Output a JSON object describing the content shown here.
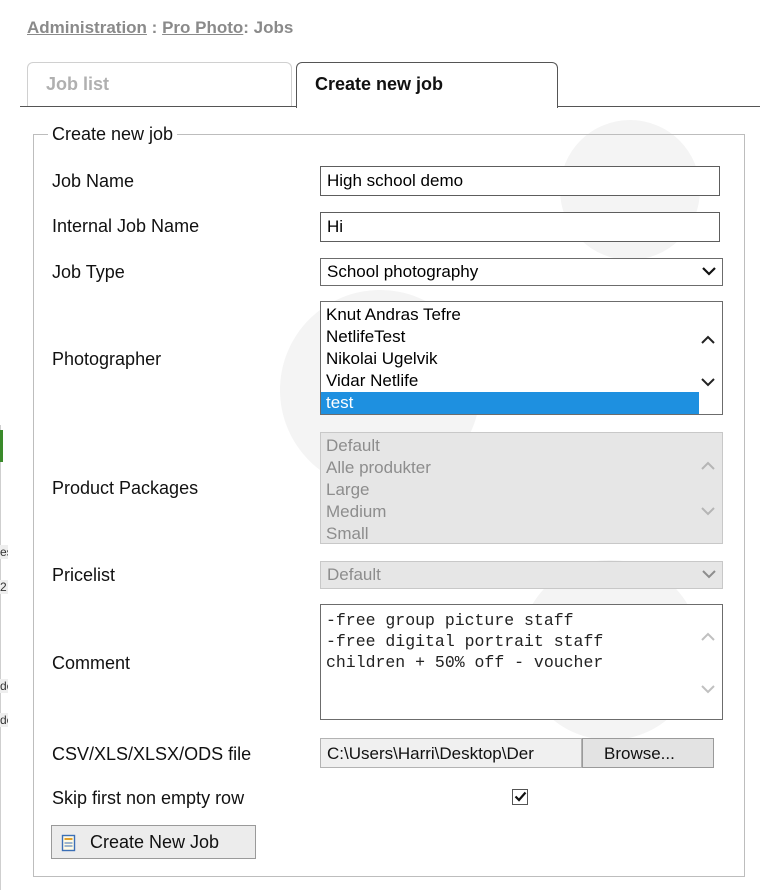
{
  "breadcrumb": {
    "link1": "Administration",
    "sep1": " : ",
    "link2": "Pro Photo",
    "tail": ": Jobs"
  },
  "tabs": {
    "job_list": "Job list",
    "create_new_job": "Create new job"
  },
  "form": {
    "legend": "Create new job",
    "job_name": {
      "label": "Job Name",
      "value": "High school demo"
    },
    "internal_job_name": {
      "label": "Internal Job Name",
      "value": "Hi"
    },
    "job_type": {
      "label": "Job Type",
      "selected": "School photography"
    },
    "photographer": {
      "label": "Photographer",
      "options": [
        "Knut Andras Tefre",
        "NetlifeTest",
        "Nikolai Ugelvik",
        "Vidar Netlife",
        "test"
      ],
      "selected_index": 4
    },
    "product_packages": {
      "label": "Product Packages",
      "options": [
        "Default",
        "Alle produkter",
        "Large",
        "Medium",
        "Small"
      ]
    },
    "pricelist": {
      "label": "Pricelist",
      "selected": "Default"
    },
    "comment": {
      "label": "Comment",
      "lines": [
        "-free group picture staff",
        "-free digital portrait staff",
        "children + 50% off - voucher"
      ]
    },
    "file": {
      "label": "CSV/XLS/XLSX/ODS file",
      "path": "C:\\Users\\Harri\\Desktop\\Der",
      "browse": "Browse..."
    },
    "skip_first_row": {
      "label": "Skip first non empty row",
      "checked": true
    },
    "submit": "Create New Job"
  },
  "background_fragments": {
    "frag1": "es",
    "frag2": "2",
    "frag3": "de",
    "frag4": "de"
  },
  "colors": {
    "selection": "#1e90e0",
    "disabled_bg": "#e6e6e6",
    "breadcrumb": "#8a8a8a"
  }
}
